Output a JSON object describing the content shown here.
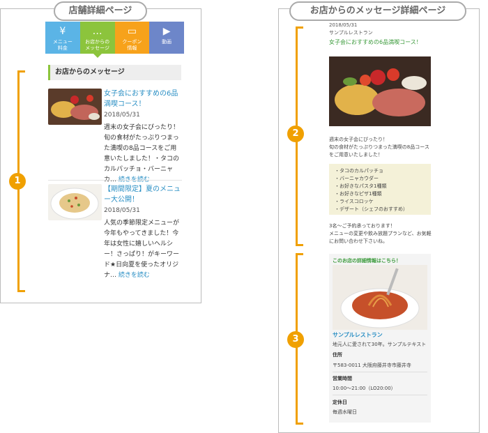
{
  "left_panel": {
    "title": "店舗詳細ページ",
    "badge": "1",
    "tabs": [
      {
        "icon": "¥",
        "label1": "メニュー",
        "label2": "料金",
        "color": "#5bb4e6"
      },
      {
        "icon": "…",
        "label1": "お店からの",
        "label2": "メッセージ",
        "color": "#8cc43c"
      },
      {
        "icon": "▭",
        "label1": "クーポン",
        "label2": "情報",
        "color": "#f7a21b"
      },
      {
        "icon": "▶",
        "label1": "動画",
        "label2": "",
        "color": "#6d86c9"
      }
    ],
    "section_heading": "お店からのメッセージ",
    "posts": [
      {
        "title": "女子会におすすめの6品満喫コース！",
        "date": "2018/05/31",
        "excerpt": "週末の女子会にぴったり！旬の食材がたっぷりつまった満喫の8品コースをご用意いたしました！・タコのカルパッチョ・バーニャカ…",
        "more": "続きを読む"
      },
      {
        "title": "【期間限定】夏のメニュー大公開！",
        "date": "2018/05/31",
        "excerpt": "人気の季節限定メニューが今年もやってきました！今年は女性に嬉しいヘルシー！さっぱり！がキーワード★日向夏を使ったオリジナ…",
        "more": "続きを読む"
      }
    ]
  },
  "right_panel": {
    "title": "お店からのメッセージ詳細ページ",
    "badge_2": "2",
    "badge_3": "3",
    "date": "2018/05/31",
    "shop_small": "サンプルレストラン",
    "post_title": "女子会におすすめの6品満喫コース！",
    "body1": "週末の女子会にぴったり！",
    "body2": "旬の食材がたっぷりつまった満喫の8品コースをご用意いたしました！",
    "menu_items": [
      "・タコのカルパッチョ",
      "・バーニャカウダー",
      "・お好きなパスタ1種類",
      "・お好きなピザ1種類",
      "・ライスコロッケ",
      "・デザート（シェフのおすすめ）"
    ],
    "closing1": "3名～ご予約承っております！",
    "closing2": "メニューの変更や飲み放題プランなど、お気軽にお問い合わせ下さいね。",
    "shop_box": {
      "heading": "このお店の詳細情報はこちら！",
      "name": "サンプルレストラン",
      "desc": "地元人に愛されて30年。サンプルテキスト",
      "address_label": "住所",
      "address": "〒583-0011 大阪府藤井寺市藤井寺",
      "hours_label": "営業時間",
      "hours": "10:00～21:00（LO20:00）",
      "holiday_label": "定休日",
      "holiday": "毎週水曜日"
    }
  }
}
